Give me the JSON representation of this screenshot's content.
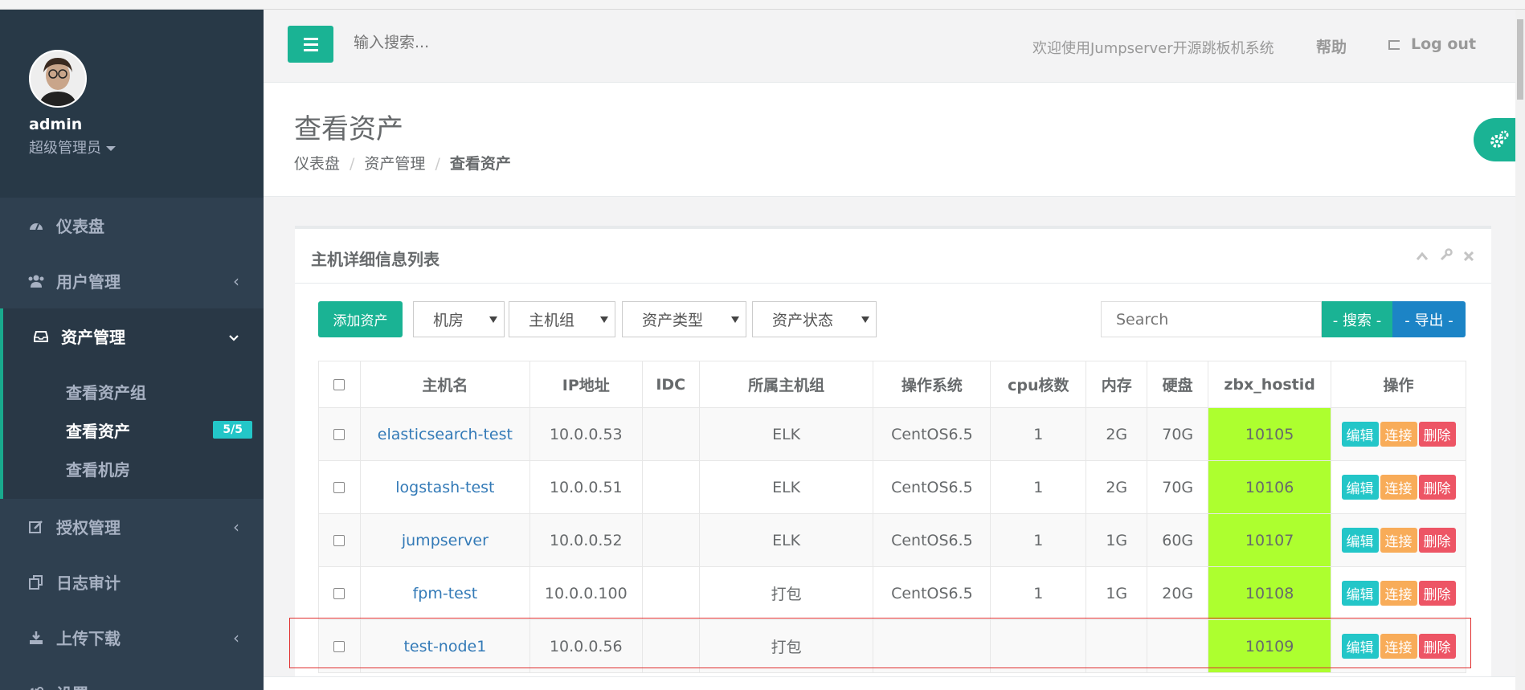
{
  "sidebar": {
    "profile": {
      "name": "admin",
      "role": "超级管理员"
    },
    "items": [
      {
        "label": "仪表盘",
        "icon": "dashboard-icon"
      },
      {
        "label": "用户管理",
        "icon": "users-icon"
      },
      {
        "label": "资产管理",
        "icon": "inbox-icon"
      },
      {
        "label": "授权管理",
        "icon": "edit-icon"
      },
      {
        "label": "日志审计",
        "icon": "copy-icon"
      },
      {
        "label": "上传下载",
        "icon": "download-icon"
      },
      {
        "label": "设置",
        "icon": "gears-icon"
      }
    ],
    "subitems": [
      {
        "label": "查看资产组"
      },
      {
        "label": "查看资产",
        "badge": "5/5"
      },
      {
        "label": "查看机房"
      }
    ]
  },
  "topbar": {
    "search_placeholder": "输入搜索...",
    "welcome": "欢迎使用Jumpserver开源跳板机系统",
    "help": "帮助",
    "logout": "Log out"
  },
  "heading": {
    "title": "查看资产",
    "breadcrumb": [
      "仪表盘",
      "资产管理",
      "查看资产"
    ]
  },
  "ibox": {
    "title": "主机详细信息列表",
    "add_button": "添加资产",
    "filters": [
      "机房",
      "主机组",
      "资产类型",
      "资产状态"
    ],
    "search_placeholder": "Search",
    "search_button": "- 搜索 -",
    "export_button": "- 导出 -"
  },
  "table": {
    "headers": [
      "主机名",
      "IP地址",
      "IDC",
      "所属主机组",
      "操作系统",
      "cpu核数",
      "内存",
      "硬盘",
      "zbx_hostid",
      "操作"
    ],
    "actions": {
      "edit": "编辑",
      "connect": "连接",
      "delete": "删除"
    },
    "rows": [
      {
        "hostname": "elasticsearch-test",
        "ip": "10.0.0.53",
        "idc": "",
        "group": "ELK",
        "os": "CentOS6.5",
        "cpu": "1",
        "mem": "2G",
        "disk": "70G",
        "zbx": "10105"
      },
      {
        "hostname": "logstash-test",
        "ip": "10.0.0.51",
        "idc": "",
        "group": "ELK",
        "os": "CentOS6.5",
        "cpu": "1",
        "mem": "2G",
        "disk": "70G",
        "zbx": "10106"
      },
      {
        "hostname": "jumpserver",
        "ip": "10.0.0.52",
        "idc": "",
        "group": "ELK",
        "os": "CentOS6.5",
        "cpu": "1",
        "mem": "1G",
        "disk": "60G",
        "zbx": "10107"
      },
      {
        "hostname": "fpm-test",
        "ip": "10.0.0.100",
        "idc": "",
        "group": "打包",
        "os": "CentOS6.5",
        "cpu": "1",
        "mem": "1G",
        "disk": "20G",
        "zbx": "10108"
      },
      {
        "hostname": "test-node1",
        "ip": "10.0.0.56",
        "idc": "",
        "group": "打包",
        "os": "",
        "cpu": "",
        "mem": "",
        "disk": "",
        "zbx": "10109"
      }
    ]
  },
  "colors": {
    "sidebar_bg": "#2f4050",
    "primary": "#1ab394",
    "info": "#23c6c8",
    "warning": "#f8ac59",
    "danger": "#ed5565",
    "zbx_highlight": "#adff2f"
  }
}
